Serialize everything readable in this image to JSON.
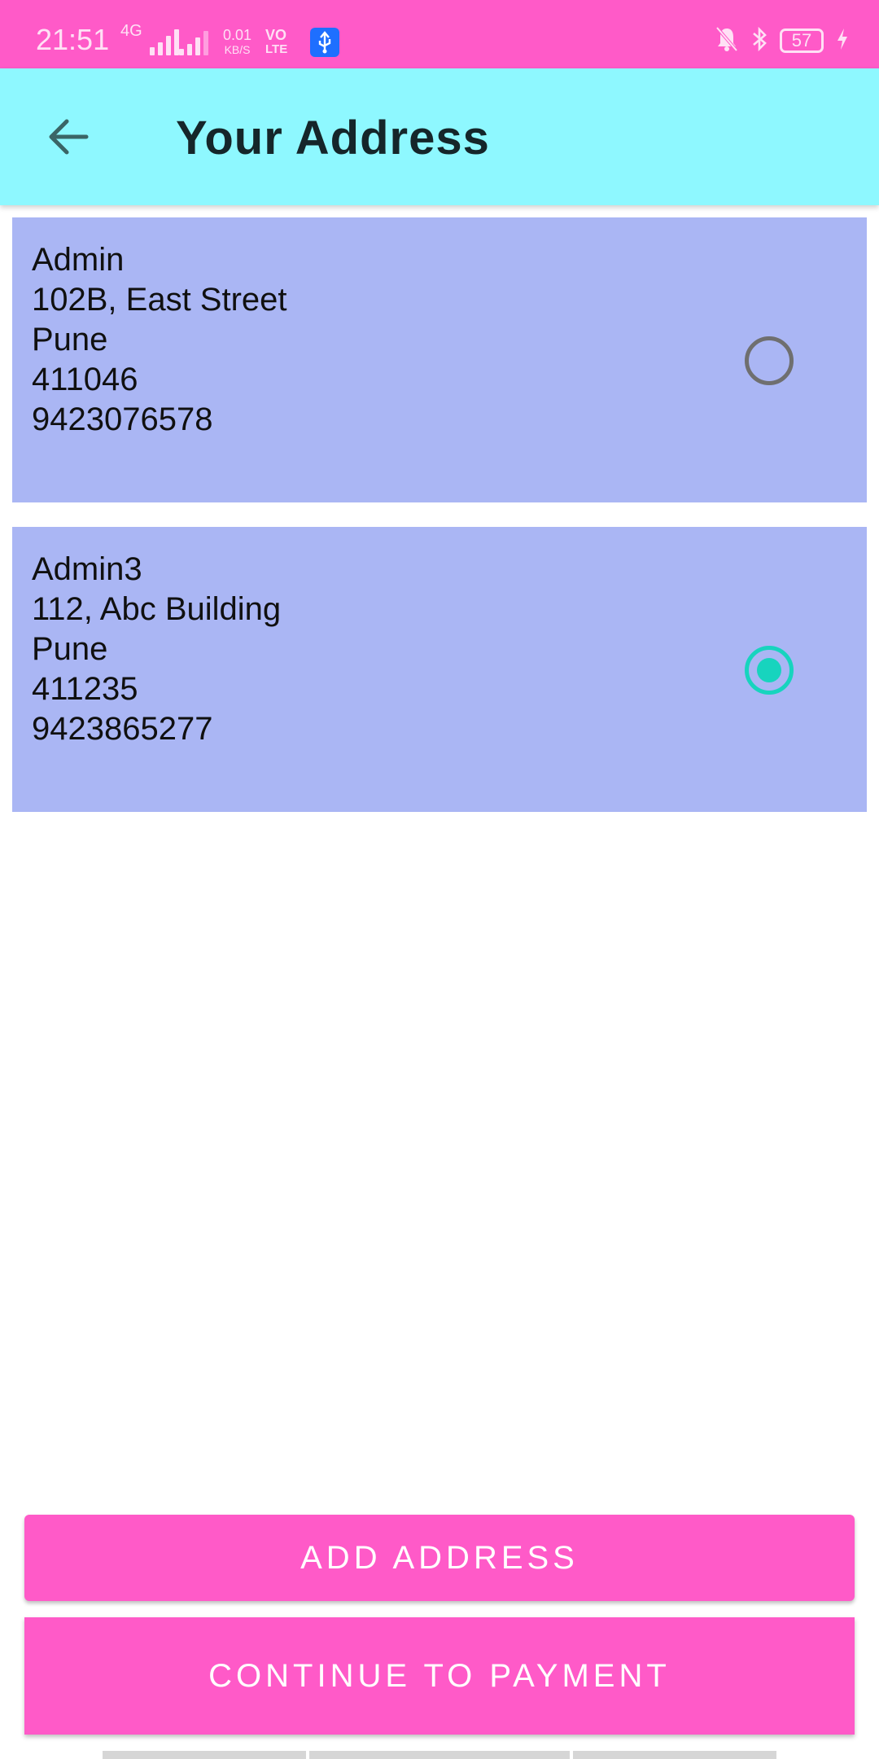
{
  "status_bar": {
    "time": "21:51",
    "network": "4G",
    "speed_value": "0.01",
    "speed_unit": "KB/S",
    "volte_top": "VO",
    "volte_bottom": "LTE",
    "battery": "57",
    "icons": [
      "usb-icon",
      "bell-muted-icon",
      "bluetooth-icon",
      "charging-icon"
    ]
  },
  "app_bar": {
    "title": "Your Address",
    "back_icon": "arrow-left-icon"
  },
  "addresses": [
    {
      "name": "Admin",
      "street": "102B, East Street",
      "city": "Pune",
      "pincode": "411046",
      "phone": "9423076578",
      "selected": false
    },
    {
      "name": "Admin3",
      "street": "112, Abc Building",
      "city": "Pune",
      "pincode": "411235",
      "phone": "9423865277",
      "selected": true
    }
  ],
  "buttons": {
    "add_address": "ADD ADDRESS",
    "continue_payment": "CONTINUE TO PAYMENT"
  },
  "colors": {
    "status_bar": "#FF5AC8",
    "app_bar": "#8EF8FF",
    "card": "#AAB6F4",
    "radio_selected": "#17D4BE",
    "button": "#FF5AC8"
  }
}
